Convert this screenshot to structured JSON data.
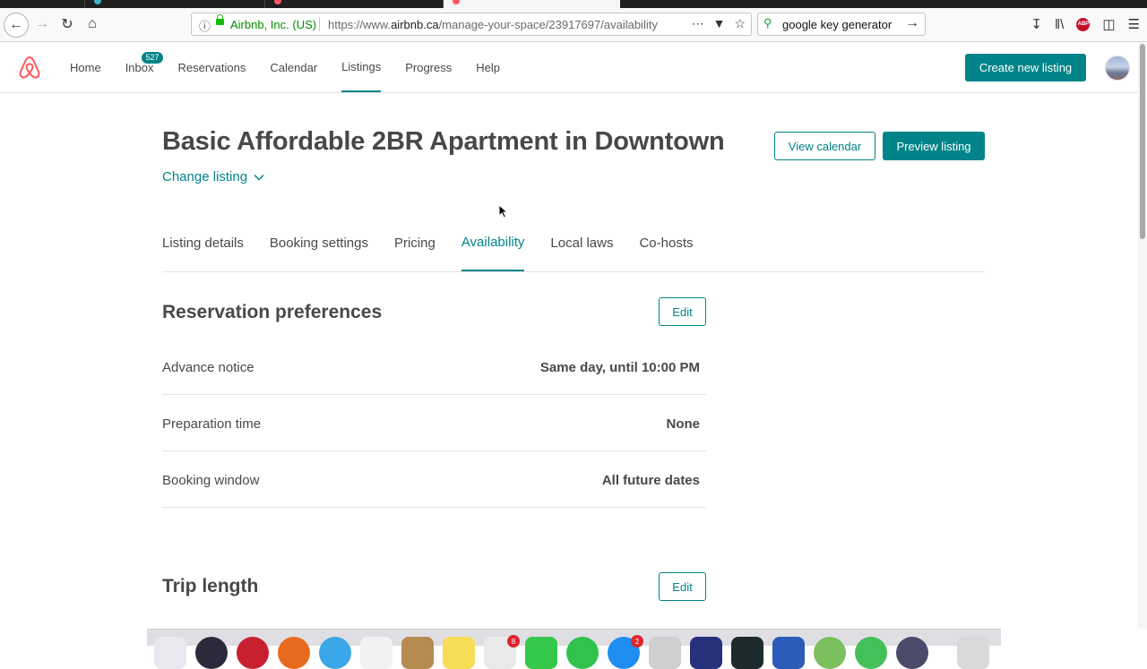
{
  "browser": {
    "url_org": "Airbnb, Inc. (US)",
    "url_prefix": "https://www.",
    "url_domain": "airbnb.ca",
    "url_path": "/manage-your-space/23917697/availability",
    "search_value": "google key generator",
    "abp_label": "ABP"
  },
  "header": {
    "nav": [
      {
        "label": "Home"
      },
      {
        "label": "Inbox",
        "badge": "527"
      },
      {
        "label": "Reservations"
      },
      {
        "label": "Calendar"
      },
      {
        "label": "Listings"
      },
      {
        "label": "Progress"
      },
      {
        "label": "Help"
      }
    ],
    "create_label": "Create new listing"
  },
  "listing": {
    "title": "Basic Affordable 2BR Apartment in Downtown",
    "change_label": "Change listing",
    "view_calendar_label": "View calendar",
    "preview_label": "Preview listing"
  },
  "tabs": [
    {
      "label": "Listing details"
    },
    {
      "label": "Booking settings"
    },
    {
      "label": "Pricing"
    },
    {
      "label": "Availability"
    },
    {
      "label": "Local laws"
    },
    {
      "label": "Co-hosts"
    }
  ],
  "reservation_preferences": {
    "title": "Reservation preferences",
    "edit_label": "Edit",
    "rows": [
      {
        "label": "Advance notice",
        "value": "Same day, until 10:00 PM"
      },
      {
        "label": "Preparation time",
        "value": "None"
      },
      {
        "label": "Booking window",
        "value": "All future dates"
      }
    ]
  },
  "trip_length": {
    "title": "Trip length",
    "edit_label": "Edit"
  },
  "dock": {
    "badges": [
      "8",
      "2"
    ]
  },
  "colors": {
    "brand_teal": "#008489",
    "airbnb_red": "#FF5A5F",
    "text": "#484848"
  }
}
